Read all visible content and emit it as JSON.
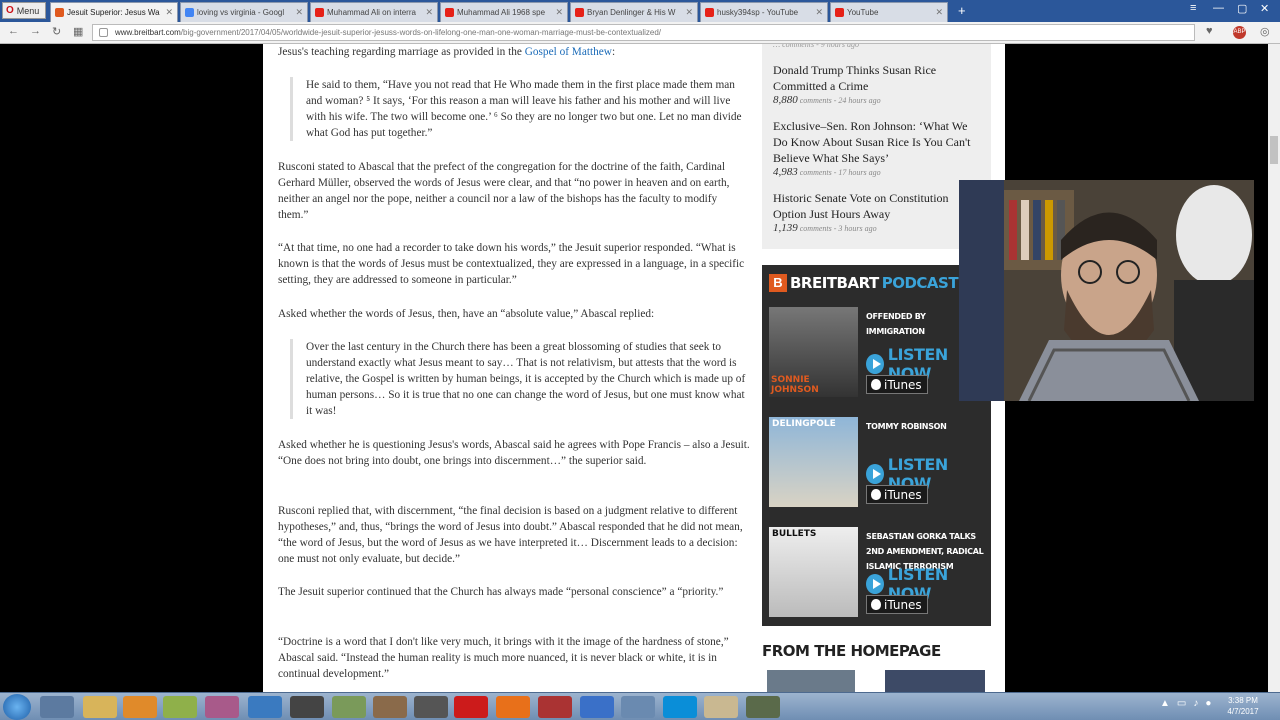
{
  "browser": {
    "menu_label": "Menu",
    "tabs": [
      {
        "label": "Jesuit Superior: Jesus Wa",
        "color": "#e05a1f",
        "active": true
      },
      {
        "label": "loving vs virginia - Googl",
        "color": "#4285f4",
        "active": false
      },
      {
        "label": "Muhammad Ali on interra",
        "color": "#e62117",
        "active": false
      },
      {
        "label": "Muhammad Ali 1968 spe",
        "color": "#e62117",
        "active": false
      },
      {
        "label": "Bryan Denlinger & His W",
        "color": "#e62117",
        "active": false
      },
      {
        "label": "husky394sp - YouTube",
        "color": "#e62117",
        "active": false
      },
      {
        "label": "YouTube",
        "color": "#e62117",
        "active": false
      }
    ],
    "url_host": "www.breitbart.com",
    "url_path": "/big-government/2017/04/05/worldwide-jesuit-superior-jesuss-words-on-lifelong-one-man-one-woman-marriage-must-be-contextualized/"
  },
  "article": {
    "intro_text": "Jesus's teaching regarding marriage as provided in the ",
    "intro_link": "Gospel of Matthew",
    "intro_end": ":",
    "quote1": "He said to them, “Have you not read that He Who made them in the first place made them man and woman? ⁵ It says, ‘For this reason a man will leave his father and his mother and will live with his wife. The two will become one.’ ⁶ So they are no longer two but one. Let no man divide what God has put together.”",
    "p1": "Rusconi stated to Abascal that the prefect of the congregation for the doctrine of the faith, Cardinal Gerhard Müller, observed the words of Jesus were clear, and that “no power in heaven and on earth, neither an angel nor the pope, neither a council nor a law of the bishops has the faculty to modify them.”",
    "p2": "“At that time, no one had a recorder to take down his words,” the Jesuit superior responded. “What is known is that the words of Jesus must be contextualized, they are expressed in a language, in a specific setting, they are addressed to someone in particular.”",
    "p3": "Asked whether the words of Jesus, then, have an “absolute value,” Abascal replied:",
    "quote2": "Over the last century in the Church there has been a great blossoming of studies that seek to understand exactly what Jesus meant to say… That is not relativism, but attests that the word is relative, the Gospel is written by human beings, it is accepted by the Church which is made up of human persons… So it is true that no one can change the word of Jesus, but one must know what it was!",
    "p4": "Asked whether he is questioning Jesus's words, Abascal said he agrees with Pope Francis – also a Jesuit. “One does not bring into doubt, one brings into discernment…” the superior said.",
    "p5": "Rusconi replied that, with discernment, “the final decision is based on a judgment relative to different hypotheses,” and, thus, “brings the word of Jesus into doubt.” Abascal responded that he did not mean, “the word of Jesus, but the word of Jesus as we have interpreted it… Discernment leads to a decision: one must not only evaluate, but decide.”",
    "p6": "The Jesuit superior continued that the Church has always made “personal conscience” a “priority.”",
    "p7": "“Doctrine is a word that I don't like very much, it brings with it the image of the hardness of stone,” Abascal said. “Instead the human reality is much more nuanced, it is never black or white, it is in continual development.”"
  },
  "sidebar": {
    "news": [
      {
        "title": "Donald Trump Thinks Susan Rice Committed a Crime",
        "count": "8,880",
        "comments": "comments",
        "age": "- 24 hours ago"
      },
      {
        "title": "Exclusive–Sen. Ron Johnson: ‘What We Do Know About Susan Rice Is You Can't Believe What She Says’",
        "count": "4,983",
        "comments": "comments",
        "age": "- 17 hours ago"
      },
      {
        "title": "Historic Senate Vote on Constitution Option Just Hours Away",
        "count": "1,139",
        "comments": "comments",
        "age": "- 3 hours ago"
      }
    ],
    "podcasts": {
      "brand": "BREITBART",
      "tag": "PODCASTS",
      "listen_label": "LISTEN NOW",
      "itunes_label": "iTunes",
      "items": [
        {
          "title": "OFFENDED BY IMMIGRATION",
          "thumb_label": "SONNIE JOHNSON"
        },
        {
          "title": "TOMMY ROBINSON",
          "thumb_label": "DELINGPOLE"
        },
        {
          "title": "SEBASTIAN GORKA TALKS 2ND AMENDMENT, RADICAL ISLAMIC TERRORISM",
          "thumb_label": "BULLETS"
        }
      ]
    },
    "homepage_heading": "FROM THE HOMEPAGE"
  },
  "taskbar": {
    "time": "3:38 PM",
    "date": "4/7/2017"
  }
}
